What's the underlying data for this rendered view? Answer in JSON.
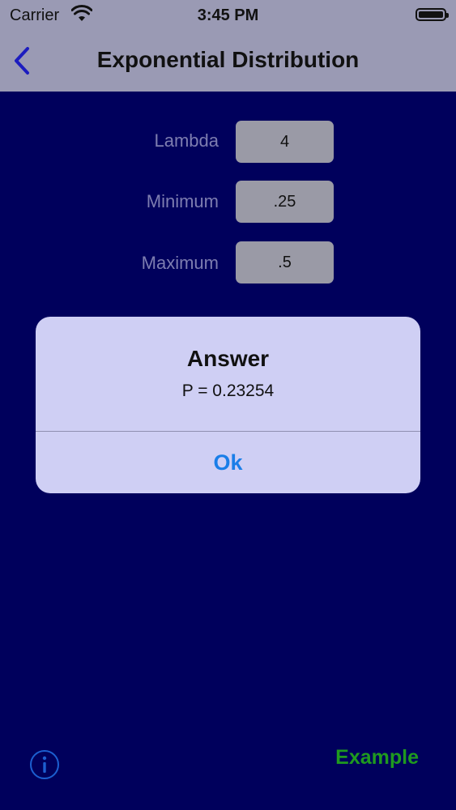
{
  "status_bar": {
    "carrier": "Carrier",
    "time": "3:45 PM",
    "icons": [
      "wifi-icon",
      "battery-icon"
    ]
  },
  "nav": {
    "title": "Exponential Distribution",
    "back_icon": "chevron-left-icon"
  },
  "form": {
    "lambda": {
      "label": "Lambda",
      "value": "4"
    },
    "minimum": {
      "label": "Minimum",
      "value": ".25"
    },
    "maximum": {
      "label": "Maximum",
      "value": ".5"
    }
  },
  "alert": {
    "title": "Answer",
    "message": "P = 0.23254",
    "ok_label": "Ok"
  },
  "footer": {
    "info_icon": "info-icon",
    "example_label": "Example"
  },
  "colors": {
    "background": "#00005c",
    "accent_blue": "#1a7ee8",
    "example_green": "#1f9a1f"
  }
}
